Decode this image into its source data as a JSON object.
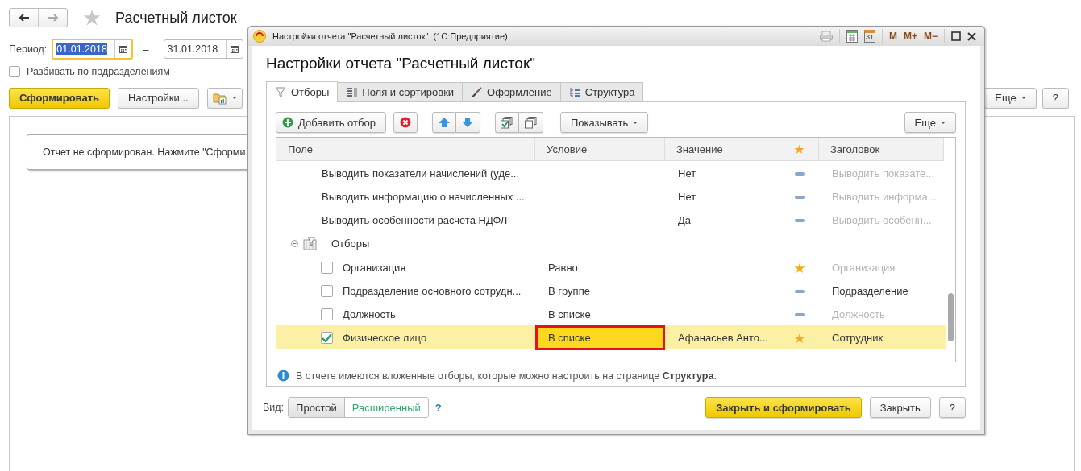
{
  "main": {
    "title": "Расчетный листок",
    "favorite": false,
    "period": {
      "label": "Период:",
      "from": "01.01.2018",
      "from_focused": true,
      "dash": "–",
      "to": "31.01.2018"
    },
    "split_checkbox": {
      "label": "Разбивать по подразделениям",
      "checked": false
    },
    "buttons": [
      {
        "label": "Сформировать",
        "kind": "default"
      },
      {
        "label": "Настройки...",
        "kind": "plain"
      },
      {
        "kind": "report-menu"
      }
    ],
    "right_buttons": [
      {
        "label": "Еще",
        "kind": "menu"
      },
      {
        "label": "?",
        "kind": "plain"
      }
    ],
    "message": "Отчет не сформирован. Нажмите \"Сформи"
  },
  "dialog": {
    "title": "Настройки отчета \"Расчетный листок\"  (1С:Предприятие)",
    "title_tools": [
      {
        "kind": "print"
      },
      {
        "kind": "calculator"
      },
      {
        "kind": "calendar",
        "label": "31"
      },
      {
        "kind": "text",
        "label": "M"
      },
      {
        "kind": "text",
        "label": "M+"
      },
      {
        "kind": "text",
        "label": "M−"
      },
      {
        "kind": "maximize"
      },
      {
        "kind": "close"
      }
    ],
    "heading": "Настройки отчета \"Расчетный листок\"",
    "tabs": [
      {
        "label": "Отборы",
        "kind": "funnel",
        "selected": true
      },
      {
        "label": "Поля и сортировки",
        "kind": "fields",
        "selected": false
      },
      {
        "label": "Оформление",
        "kind": "brush",
        "selected": false
      },
      {
        "label": "Структура",
        "kind": "structure",
        "selected": false
      }
    ],
    "toolbar": [
      {
        "kind": "add",
        "label": "Добавить отбор"
      },
      {
        "kind": "delete"
      },
      {
        "kind": "up"
      },
      {
        "kind": "down"
      },
      {
        "kind": "check-all"
      },
      {
        "kind": "uncheck-all"
      },
      {
        "kind": "menu",
        "label": "Показывать"
      }
    ],
    "toolbar_more": "Еще",
    "table": {
      "columns": [
        "Поле",
        "Условие",
        "Значение",
        "Заголовок"
      ],
      "rows": [
        {
          "kind": "parameter",
          "field": "Выводить показатели начислений (уде...",
          "value": "Нет",
          "quick": false,
          "title": "Выводить показате...",
          "title_default": true,
          "selected": false
        },
        {
          "kind": "parameter",
          "field": "Выводить информацию о начисленных ...",
          "value": "Нет",
          "quick": false,
          "title": "Выводить информа...",
          "title_default": true,
          "selected": false
        },
        {
          "kind": "parameter",
          "field": "Выводить особенности расчета НДФЛ",
          "value": "Да",
          "quick": false,
          "title": "Выводить особенн...",
          "title_default": true,
          "selected": false
        },
        {
          "kind": "group",
          "field": "Отборы",
          "expanded": true,
          "selected": false,
          "children": [
            {
              "kind": "filter",
              "checked": false,
              "field": "Организация",
              "condition": "Равно",
              "quick": true,
              "title": "Организация",
              "title_default": true,
              "selected": false,
              "condition_highlighted": false
            },
            {
              "kind": "filter",
              "checked": false,
              "field": "Подразделение основного сотрудн...",
              "condition": "В группе",
              "quick": false,
              "title": "Подразделение",
              "title_default": false,
              "selected": false,
              "condition_highlighted": false
            },
            {
              "kind": "filter",
              "checked": false,
              "field": "Должность",
              "condition": "В списке",
              "quick": false,
              "title": "Должность",
              "title_default": true,
              "selected": false,
              "condition_highlighted": false
            },
            {
              "kind": "filter",
              "checked": true,
              "field": "Физическое лицо",
              "condition": "В списке",
              "value": "Афанасьев Анто...",
              "quick": true,
              "title": "Сотрудник",
              "title_default": false,
              "selected": true,
              "condition_highlighted": true
            }
          ]
        }
      ]
    },
    "info": "В отчете имеются вложенные отборы, которые можно настроить на странице **Структура**.",
    "view": {
      "label": "Вид:",
      "options": [
        {
          "label": "Простой",
          "selected": true
        },
        {
          "label": "Расширенный",
          "selected": false
        }
      ],
      "help": "?"
    },
    "buttons": [
      {
        "label": "Закрыть и сформировать",
        "kind": "default"
      },
      {
        "label": "Закрыть",
        "kind": "plain"
      },
      {
        "label": "?",
        "kind": "plain"
      }
    ]
  }
}
